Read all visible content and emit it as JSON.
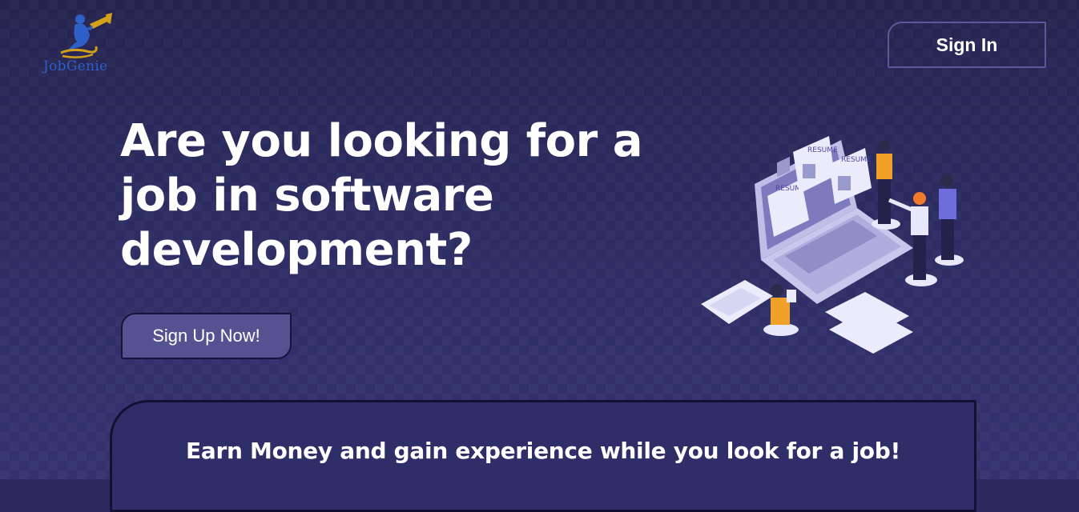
{
  "brand": {
    "logo_text": "JobGenie",
    "logo_icon": "genie-lamp-icon"
  },
  "header": {
    "signin_label": "Sign In"
  },
  "hero": {
    "headline": "Are you looking for a job in software development?",
    "signup_label": "Sign Up Now!",
    "illustration_label": "RESUME"
  },
  "feature_card": {
    "text": "Earn Money and gain experience while you look for a job!"
  },
  "colors": {
    "background": "#2b2a5e",
    "button_fill": "#545291",
    "logo_blue": "#2f5fc8",
    "logo_gold": "#d4a017"
  }
}
